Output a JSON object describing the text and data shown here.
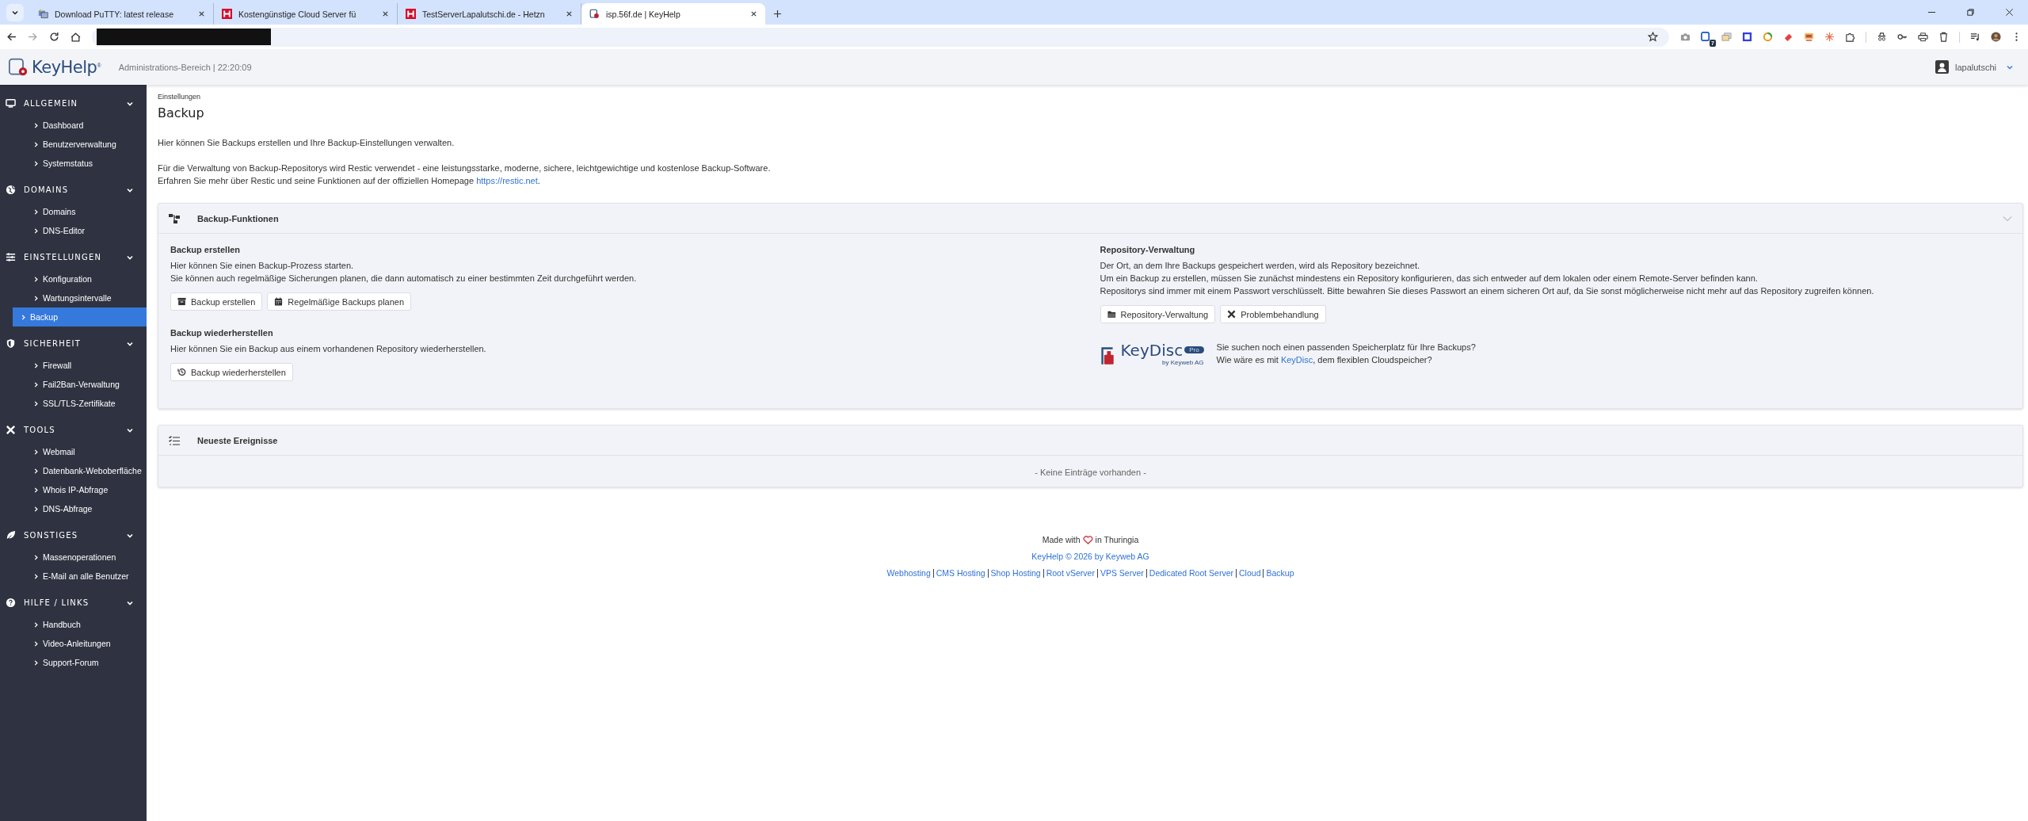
{
  "browser": {
    "tabs": [
      {
        "title": "Download PuTTY: latest release",
        "kind": "putty",
        "selected": false
      },
      {
        "title": "Kostengünstige Cloud Server fü",
        "kind": "hetzner",
        "selected": false
      },
      {
        "title": "TestServerLapalutschi.de - Hetzn",
        "kind": "hetzner",
        "selected": false
      },
      {
        "title": "isp.56f.de | KeyHelp",
        "kind": "keyhelp",
        "selected": true
      }
    ],
    "extension_badge": "7"
  },
  "header": {
    "logo": "KeyHelp",
    "logo_mark": "®",
    "subtitle": "Administrations-Bereich | 22:20:09",
    "user": "lapalutschi"
  },
  "sidebar": [
    {
      "title": "ALLGEMEIN",
      "kind": "monitor",
      "expanded": true,
      "items": [
        {
          "label": "Dashboard",
          "selected": false
        },
        {
          "label": "Benutzerverwaltung",
          "selected": false
        },
        {
          "label": "Systemstatus",
          "selected": false
        }
      ]
    },
    {
      "title": "DOMAINS",
      "kind": "globe",
      "expanded": true,
      "items": [
        {
          "label": "Domains",
          "selected": false
        },
        {
          "label": "DNS-Editor",
          "selected": false
        }
      ]
    },
    {
      "title": "EINSTELLUNGEN",
      "kind": "sliders",
      "expanded": true,
      "items": [
        {
          "label": "Konfiguration",
          "selected": false
        },
        {
          "label": "Wartungsintervalle",
          "selected": false
        },
        {
          "label": "Backup",
          "selected": true
        }
      ]
    },
    {
      "title": "SICHERHEIT",
      "kind": "shield",
      "expanded": true,
      "items": [
        {
          "label": "Firewall",
          "selected": false
        },
        {
          "label": "Fail2Ban-Verwaltung",
          "selected": false
        },
        {
          "label": "SSL/TLS-Zertifikate",
          "selected": false
        }
      ]
    },
    {
      "title": "TOOLS",
      "kind": "tools",
      "expanded": true,
      "items": [
        {
          "label": "Webmail",
          "selected": false
        },
        {
          "label": "Datenbank-Weboberfläche",
          "selected": false
        },
        {
          "label": "Whois IP-Abfrage",
          "selected": false
        },
        {
          "label": "DNS-Abfrage",
          "selected": false
        }
      ]
    },
    {
      "title": "SONSTIGES",
      "kind": "leaf",
      "expanded": true,
      "items": [
        {
          "label": "Massenoperationen",
          "selected": false
        },
        {
          "label": "E-Mail an alle Benutzer",
          "selected": false
        }
      ]
    },
    {
      "title": "HILFE / LINKS",
      "kind": "question",
      "expanded": true,
      "items": [
        {
          "label": "Handbuch",
          "selected": false
        },
        {
          "label": "Video-Anleitungen",
          "selected": false
        },
        {
          "label": "Support-Forum",
          "selected": false
        }
      ]
    }
  ],
  "breadcrumb": "Einstellungen",
  "title": "Backup",
  "intro": "Hier können Sie Backups erstellen und Ihre Backup-Einstellungen verwalten.",
  "restic_text": "Für die Verwaltung von Backup-Repositorys wird Restic verwendet - eine leistungsstarke, moderne, sichere, leichtgewichtige und kostenlose Backup-Software.",
  "restic_more": {
    "before": "Erfahren Sie mehr über Restic und seine Funktionen auf der offiziellen Homepage ",
    "link": "https://restic.net",
    "after": "."
  },
  "functions_panel": {
    "title": "Backup-Funktionen",
    "expanded": true,
    "left": [
      {
        "heading": "Backup erstellen",
        "lines": [
          "Hier können Sie einen Backup-Prozess starten.",
          "Sie können auch regelmäßige Sicherungen planen, die dann automatisch zu einer bestimmten Zeit durchgeführt werden."
        ],
        "buttons": [
          {
            "label": "Backup erstellen",
            "kind": "archive"
          },
          {
            "label": "Regelmäßige Backups planen",
            "kind": "calendar"
          }
        ]
      },
      {
        "heading": "Backup wiederherstellen",
        "lines": [
          "Hier können Sie ein Backup aus einem vorhandenen Repository wiederherstellen."
        ],
        "buttons": [
          {
            "label": "Backup wiederherstellen",
            "kind": "history"
          }
        ]
      }
    ],
    "right": [
      {
        "heading": "Repository-Verwaltung",
        "lines": [
          "Der Ort, an dem Ihre Backups gespeichert werden, wird als Repository bezeichnet.",
          "Um ein Backup zu erstellen, müssen Sie zunächst mindestens ein Repository konfigurieren, das sich entweder auf dem lokalen oder einem Remote-Server befinden kann.",
          "Repositorys sind immer mit einem Passwort verschlüsselt. Bitte bewahren Sie dieses Passwort an einem sicheren Ort auf, da Sie sonst möglicherweise nicht mehr auf das Repository zugreifen können."
        ],
        "buttons": [
          {
            "label": "Repository-Verwaltung",
            "kind": "folder"
          },
          {
            "label": "Problembehandlung",
            "kind": "tools"
          }
        ]
      }
    ],
    "promo": {
      "logo": "KeyDisc",
      "logo_badge": "Pro",
      "logo_sub": "by Keyweb AG",
      "line1": "Sie suchen noch einen passenden Speicherplatz für Ihre Backups?",
      "line2_before": "Wie wäre es mit ",
      "line2_link": "KeyDisc",
      "line2_after": ", dem flexiblen Cloudspeicher?"
    }
  },
  "events_panel": {
    "title": "Neueste Ereignisse",
    "empty": "- Keine Einträge vorhanden -"
  },
  "footer": {
    "made_before": "Made with",
    "made_after": "in Thuringia",
    "copyright": "KeyHelp © 2026 by Keyweb AG",
    "links": [
      "Webhosting",
      "CMS Hosting",
      "Shop Hosting",
      "Root vServer",
      "VPS Server",
      "Dedicated Root Server",
      "Cloud",
      "Backup"
    ]
  }
}
